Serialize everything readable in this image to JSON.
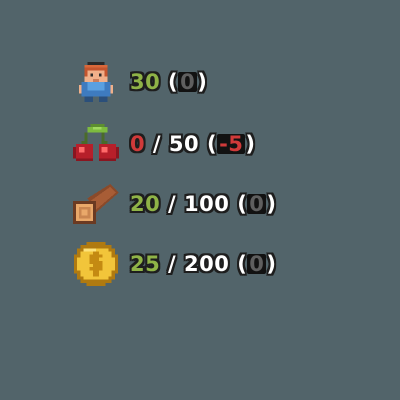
{
  "colors": {
    "background": "#52646a",
    "good": "#8fb347",
    "bad": "#d03a3a",
    "neutral_delta": "#5f5f5f",
    "text": "#ffffff",
    "outline": "#1e1e1e"
  },
  "resources": [
    {
      "id": "population",
      "icon": "worker-icon",
      "current": "30",
      "current_color": "#8fb347",
      "max": null,
      "delta": "0",
      "delta_color": "#5f5f5f"
    },
    {
      "id": "food",
      "icon": "cherry-icon",
      "current": "0",
      "current_color": "#d03a3a",
      "max": "50",
      "delta": "-5",
      "delta_color": "#d03a3a"
    },
    {
      "id": "wood",
      "icon": "log-icon",
      "current": "20",
      "current_color": "#8fb347",
      "max": "100",
      "delta": "0",
      "delta_color": "#5f5f5f"
    },
    {
      "id": "gold",
      "icon": "coin-icon",
      "current": "25",
      "current_color": "#8fb347",
      "max": "200",
      "delta": "0",
      "delta_color": "#5f5f5f"
    }
  ],
  "separator": " / ",
  "paren_open": "(",
  "paren_close": ")"
}
